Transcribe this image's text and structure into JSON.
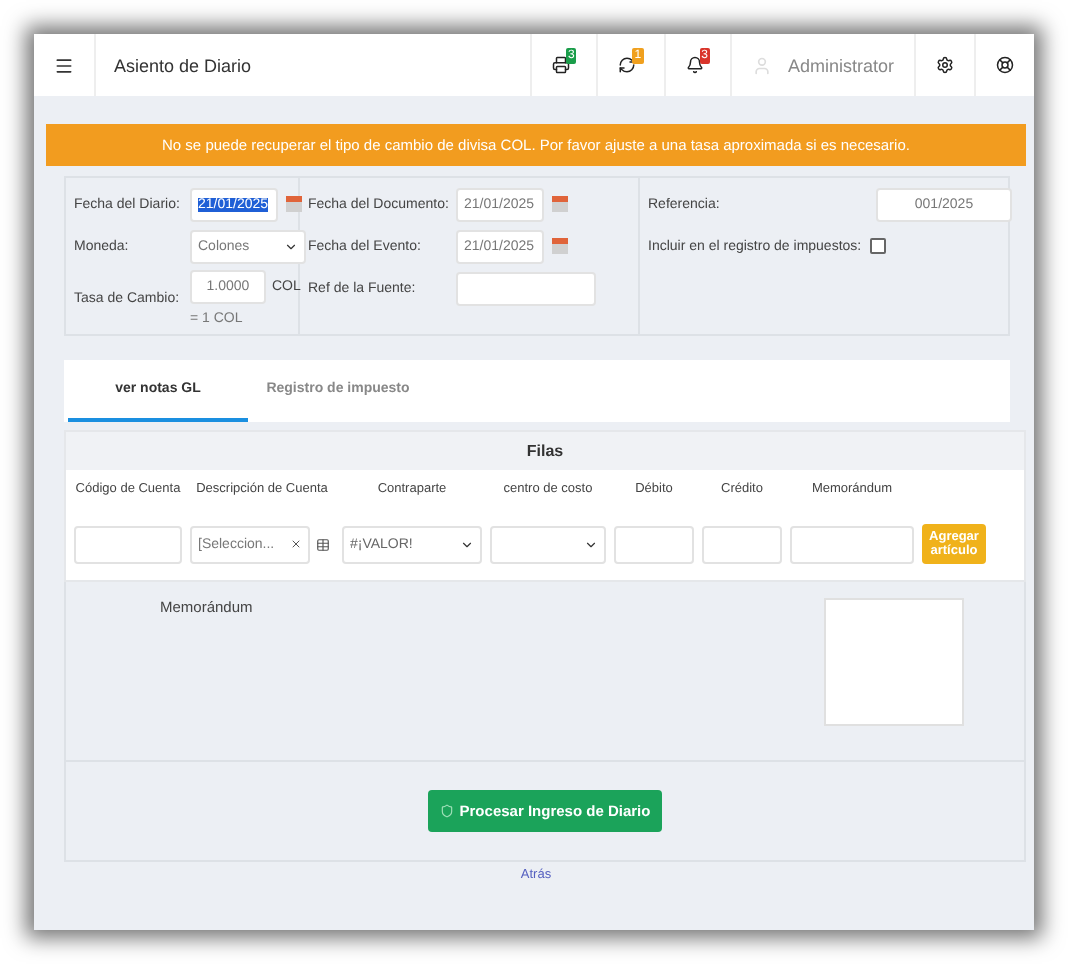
{
  "header": {
    "title": "Asiento de Diario",
    "notifications": [
      {
        "count": "3",
        "color": "#1a9d4a"
      },
      {
        "count": "1",
        "color": "#f0a01e"
      },
      {
        "count": "3",
        "color": "#d9342b"
      }
    ],
    "user": "Administrator"
  },
  "alert": "No se puede recuperar el tipo de cambio de divisa COL. Por favor ajuste a una tasa aproximada si es necesario.",
  "form_columns": [
    [
      {
        "kind": "date",
        "label": "Fecha del Diario:",
        "value": "21/01/2025",
        "selected": true
      },
      {
        "kind": "select",
        "label": "Moneda:",
        "value": "Colones"
      },
      {
        "kind": "rate",
        "label": "Tasa de Cambio:",
        "value": "1.0000",
        "suffix": "COL",
        "note": "= 1 COL"
      }
    ],
    [
      {
        "kind": "date",
        "label": "Fecha del Documento:",
        "value": "21/01/2025",
        "selected": false
      },
      {
        "kind": "date",
        "label": "Fecha del Evento:",
        "value": "21/01/2025",
        "selected": false
      },
      {
        "kind": "text",
        "label": "Ref de la Fuente:"
      }
    ],
    [
      {
        "kind": "text",
        "label": "Referencia:",
        "value": "001/2025"
      },
      {
        "kind": "checkbox",
        "label": "Incluir en el registro de impuestos:",
        "checked": false
      }
    ]
  ],
  "tabs": [
    {
      "label": "ver notas GL",
      "selected": true
    },
    {
      "label": "Registro de impuesto",
      "selected": false
    }
  ],
  "lines": {
    "title": "Filas",
    "columns": [
      "Código de Cuenta",
      "Descripción de Cuenta",
      "Contraparte",
      "centro de costo",
      "Débito",
      "Crédito",
      "Memorándum"
    ],
    "entry": [
      {
        "kind": "input"
      },
      {
        "kind": "combo",
        "placeholder": "[Seleccion..."
      },
      {
        "kind": "select",
        "value": "#¡VALOR!"
      },
      {
        "kind": "select"
      },
      {
        "kind": "input"
      },
      {
        "kind": "input"
      },
      {
        "kind": "input"
      }
    ],
    "add_button": "Agregar artículo"
  },
  "memo_label": "Memorándum",
  "submit": "Procesar Ingreso de Diario",
  "back_link": "Atrás"
}
